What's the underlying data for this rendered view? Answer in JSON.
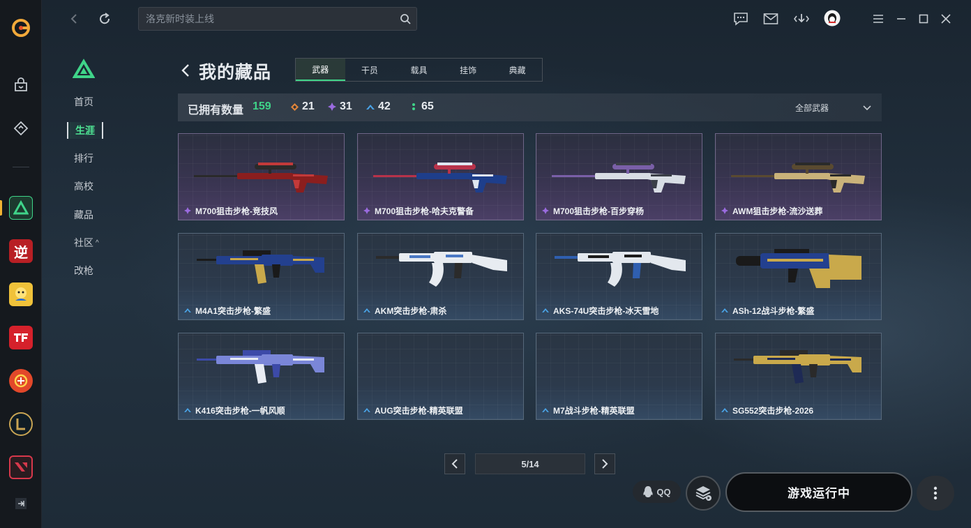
{
  "search": {
    "placeholder": "洛克新时装上线"
  },
  "nav": {
    "items": [
      {
        "label": "首页",
        "active": false
      },
      {
        "label": "生涯",
        "active": true
      },
      {
        "label": "排行",
        "active": false
      },
      {
        "label": "高校",
        "active": false
      },
      {
        "label": "藏品",
        "active": false
      },
      {
        "label": "社区",
        "active": false
      },
      {
        "label": "改枪",
        "active": false
      }
    ],
    "community_caret": "^"
  },
  "rail": {
    "games": [
      {
        "icon": "delta-force-icon",
        "text": "",
        "color": "#3fd489"
      },
      {
        "icon": "ni-shui-han-icon",
        "text": "逆",
        "color": "#d42a2a"
      },
      {
        "icon": "game-avatar-icon",
        "text": "",
        "color": "#e8b53a"
      },
      {
        "icon": "tf-icon",
        "text": "",
        "color": "#d5212b"
      },
      {
        "icon": "crossfire-icon",
        "text": "",
        "color": "#e2482a"
      },
      {
        "icon": "league-of-legends-icon",
        "text": "",
        "color": "#c8a453"
      },
      {
        "icon": "valorant-icon",
        "text": "",
        "color": "#d7384b"
      }
    ]
  },
  "page": {
    "title": "我的藏品"
  },
  "tabs": [
    {
      "label": "武器",
      "active": true
    },
    {
      "label": "干员",
      "active": false
    },
    {
      "label": "载具",
      "active": false
    },
    {
      "label": "挂饰",
      "active": false
    },
    {
      "label": "典藏",
      "active": false
    }
  ],
  "stats": {
    "label": "已拥有数量",
    "total": "159",
    "rarities": [
      {
        "icon": "orange-diamond-icon",
        "color": "#e0843a",
        "count": "21"
      },
      {
        "icon": "purple-diamond-icon",
        "color": "#9b6be0",
        "count": "31"
      },
      {
        "icon": "blue-chevron-icon",
        "color": "#4aa3e6",
        "count": "42"
      },
      {
        "icon": "green-dots-icon",
        "color": "#3fd489",
        "count": "65"
      }
    ],
    "filter": "全部武器"
  },
  "items": [
    {
      "name": "M700狙击步枪-竞技风",
      "rarity": "purple",
      "weapon": "sniper",
      "palette": [
        "#8b1e1e",
        "#c23a3a",
        "#2a2a2a"
      ]
    },
    {
      "name": "M700狙击步枪-哈夫克警备",
      "rarity": "purple",
      "weapon": "sniper",
      "palette": [
        "#1e3e8b",
        "#dfe6f0",
        "#b8324a"
      ]
    },
    {
      "name": "M700狙击步枪-百步穿杨",
      "rarity": "purple",
      "weapon": "sniper",
      "palette": [
        "#d8dde4",
        "#3b3f47",
        "#7a5fa8"
      ]
    },
    {
      "name": "AWM狙击步枪-流沙送葬",
      "rarity": "purple",
      "weapon": "sniper",
      "palette": [
        "#c9b27a",
        "#2a2a2a",
        "#5a4a30"
      ]
    },
    {
      "name": "M4A1突击步枪-繁盛",
      "rarity": "blue",
      "weapon": "rifle",
      "palette": [
        "#23408f",
        "#c9a94b",
        "#1a1a1a"
      ]
    },
    {
      "name": "AKM突击步枪-肃杀",
      "rarity": "blue",
      "weapon": "ak",
      "palette": [
        "#e8ecf1",
        "#2b2b2b",
        "#4a78c4"
      ]
    },
    {
      "name": "AKS-74U突击步枪-冰天雪地",
      "rarity": "blue",
      "weapon": "ak",
      "palette": [
        "#e3e8ee",
        "#2f5fb0",
        "#1c1c1c"
      ]
    },
    {
      "name": "ASh-12战斗步枪-繁盛",
      "rarity": "blue",
      "weapon": "bullpup",
      "palette": [
        "#23408f",
        "#c9a94b",
        "#1a1a1a"
      ]
    },
    {
      "name": "K416突击步枪-一帆风顺",
      "rarity": "blue",
      "weapon": "rifle",
      "palette": [
        "#7a86d8",
        "#e8ecf4",
        "#3c4aa8"
      ]
    },
    {
      "name": "AUG突击步枪-精英联盟",
      "rarity": "blue",
      "weapon": "none",
      "palette": []
    },
    {
      "name": "M7战斗步枪-精英联盟",
      "rarity": "blue",
      "weapon": "none",
      "palette": []
    },
    {
      "name": "SG552突击步枪-2026",
      "rarity": "blue",
      "weapon": "rifle",
      "palette": [
        "#c9a94b",
        "#1e2a55",
        "#2a2a2a"
      ]
    }
  ],
  "pagination": {
    "indicator": "5/14"
  },
  "bottom": {
    "qq_label": "QQ",
    "launch_label": "游戏运行中"
  },
  "colors": {
    "accent_green": "#3fd489",
    "purple_rarity": "#9b6be0",
    "blue_rarity": "#4aa3e6"
  }
}
